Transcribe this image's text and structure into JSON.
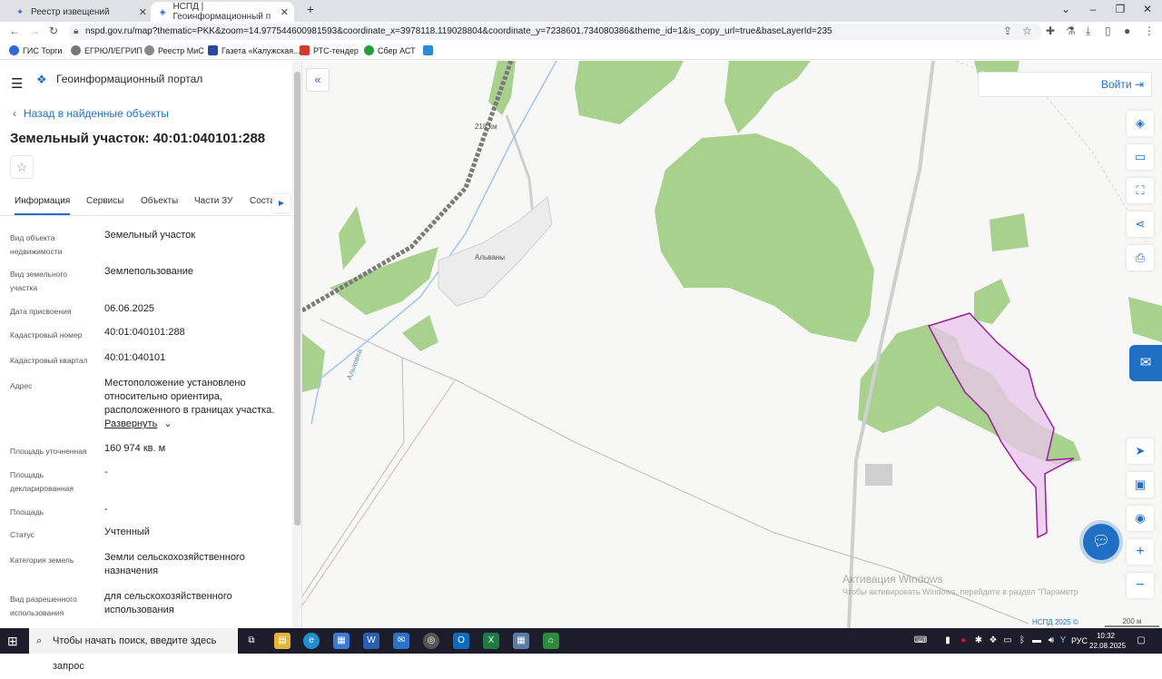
{
  "browser": {
    "tabs": [
      {
        "title": "Реестр извещений",
        "active": false
      },
      {
        "title": "НСПД | Геоинформационный п",
        "active": true
      }
    ],
    "new_tab": "+",
    "url": "nspd.gov.ru/map?thematic=PKK&zoom=14.977544600981593&coordinate_x=3978118.119028804&coordinate_y=7238601.734080386&theme_id=1&is_copy_url=true&baseLayerId=235",
    "bookmarks": [
      "ГИС Торги",
      "ЕГРЮЛ/ЕГРИП",
      "Реестр МиС",
      "Газета «Калужская...",
      "РТС-тендер",
      "Сбер АСТ"
    ]
  },
  "portal": {
    "title": "Геоинформационный портал",
    "back_link": "Назад в найденные объекты",
    "object_title": "Земельный участок: 40:01:040101:288",
    "tabs": [
      "Информация",
      "Сервисы",
      "Объекты",
      "Части ЗУ",
      "Соста"
    ],
    "fields": [
      {
        "label": "Вид объекта недвижимости",
        "value": "Земельный участок"
      },
      {
        "label": "Вид земельного участка",
        "value": "Землепользование"
      },
      {
        "label": "Дата присвоения",
        "value": "06.06.2025"
      },
      {
        "label": "Кадастровый номер",
        "value": "40:01:040101:288"
      },
      {
        "label": "Кадастровый квартал",
        "value": "40:01:040101"
      },
      {
        "label": "Адрес",
        "value": "Местоположение установлено относительно ориентира, расположенного в границах участка."
      },
      {
        "label": "Площадь уточненная",
        "value": "160 974 кв. м"
      },
      {
        "label": "Площадь декларированная",
        "value": "-"
      },
      {
        "label": "Площадь",
        "value": "-"
      },
      {
        "label": "Статус",
        "value": "Учтенный"
      },
      {
        "label": "Категория земель",
        "value": "Земли сельскохозяйственного назначения"
      },
      {
        "label": "Вид разрешенного использования",
        "value": "для сельскохозяйственного использования"
      }
    ],
    "expand_label": "Развернуть"
  },
  "map": {
    "login_label": "Войти",
    "labels": {
      "km": "218 км",
      "village": "Альваны",
      "river": "Альховка"
    },
    "copyright": "НСПД 2025 ©",
    "scale": "200 м",
    "colors": {
      "forest": "#a9d18e",
      "parcel": "#e8c6ec",
      "parcel_border": "#9b1f9e",
      "rail": "#7a7a7a",
      "water": "#9dc6ea"
    }
  },
  "watermark": {
    "line1": "Активация Windows",
    "line2": "Чтобы активировать Windows, перейдите в раздел \"Параметр"
  },
  "taskbar": {
    "search_placeholder": "Чтобы начать поиск, введите здесь запрос",
    "lang": "РУС",
    "time": "10:32",
    "date": "22.08.2025"
  }
}
